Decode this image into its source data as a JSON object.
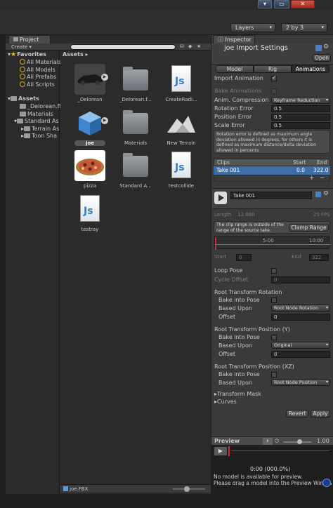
{
  "toolbar": {
    "layers_label": "Layers",
    "layout_label": "2 by 3"
  },
  "project": {
    "tab_label": "Project",
    "create_label": "Create",
    "favorites_label": "Favorites",
    "favorites": [
      "All Materials",
      "All Models",
      "All Prefabs",
      "All Scripts"
    ],
    "assets_label": "Assets",
    "tree": [
      "_Delorean.fb",
      "Materials",
      "Standard As",
      "Terrain As",
      "Toon Sha"
    ],
    "breadcrumb": "Assets",
    "items": [
      {
        "name": "_Delorean",
        "kind": "model"
      },
      {
        "name": "_Delorean.f...",
        "kind": "folder"
      },
      {
        "name": "CreateRadi...",
        "kind": "script"
      },
      {
        "name": "joe",
        "kind": "cube",
        "selected": true
      },
      {
        "name": "Materials",
        "kind": "folder"
      },
      {
        "name": "New Terrain",
        "kind": "terrain"
      },
      {
        "name": "pizza",
        "kind": "pizza"
      },
      {
        "name": "Standard A...",
        "kind": "folder"
      },
      {
        "name": "testcollide",
        "kind": "script"
      },
      {
        "name": "testray",
        "kind": "script"
      }
    ],
    "js_glyph": "Js",
    "footer_file": "joe.FBX"
  },
  "inspector": {
    "tab_label": "Inspector",
    "title": "joe Import Settings",
    "open_label": "Open",
    "tabs": [
      "Model",
      "Rig",
      "Animations"
    ],
    "active_tab": "Animations",
    "import_animation_label": "Import Animation",
    "bake_animations_label": "Bake Animations",
    "anim_compression_label": "Anim. Compression",
    "anim_compression_value": "Keyframe Reduction",
    "rotation_error_label": "Rotation Error",
    "rotation_error_value": "0.5",
    "position_error_label": "Position Error",
    "position_error_value": "0.5",
    "scale_error_label": "Scale Error",
    "scale_error_value": "0.5",
    "help_text": "Rotation error is defined as maximum angle deviation allowed in degrees, for others it is defined as maximum distance/delta deviation allowed in percents",
    "clips_header": {
      "col1": "Clips",
      "col2": "Start",
      "col3": "End"
    },
    "clip_row": {
      "name": "Take 001",
      "start": "0.0",
      "end": "322.0"
    },
    "plus_label": "+",
    "minus_label": "−",
    "take_name": "Take 001",
    "length_label": "Length",
    "length_value": "12.880",
    "fps_label": "25 FPS",
    "warning_text": "The clip range is outside of the range of the source take.",
    "clamp_range_label": "Clamp Range",
    "timeline_mark1": "5:00",
    "timeline_mark2": "10:00",
    "start_label": "Start",
    "start_value": "0",
    "end_label": "End",
    "end_value": "322",
    "loop_pose_label": "Loop Pose",
    "cycle_offset_label": "Cycle Offset",
    "cycle_offset_value": "0",
    "rt_rotation_label": "Root Transform Rotation",
    "bake_into_pose_label": "Bake into Pose",
    "based_upon_label": "Based Upon",
    "rt_rotation_based": "Root Node Rotation",
    "offset_label": "Offset",
    "offset_value": "0",
    "rt_position_y_label": "Root Transform Position (Y)",
    "rt_position_y_based": "Original",
    "rt_position_y_offset": "0",
    "rt_position_xz_label": "Root Transform Position (XZ)",
    "rt_position_xz_based": "Root Node Position",
    "transform_mask_label": "Transform Mask",
    "curves_label": "Curves",
    "revert_label": "Revert",
    "apply_label": "Apply",
    "preview_label": "Preview",
    "preview_speed": "1.00",
    "preview_time": "0:00 (000.0%)",
    "no_model_text": "No model is available for preview.",
    "drag_text": "Please drag a model into the Preview Window."
  }
}
